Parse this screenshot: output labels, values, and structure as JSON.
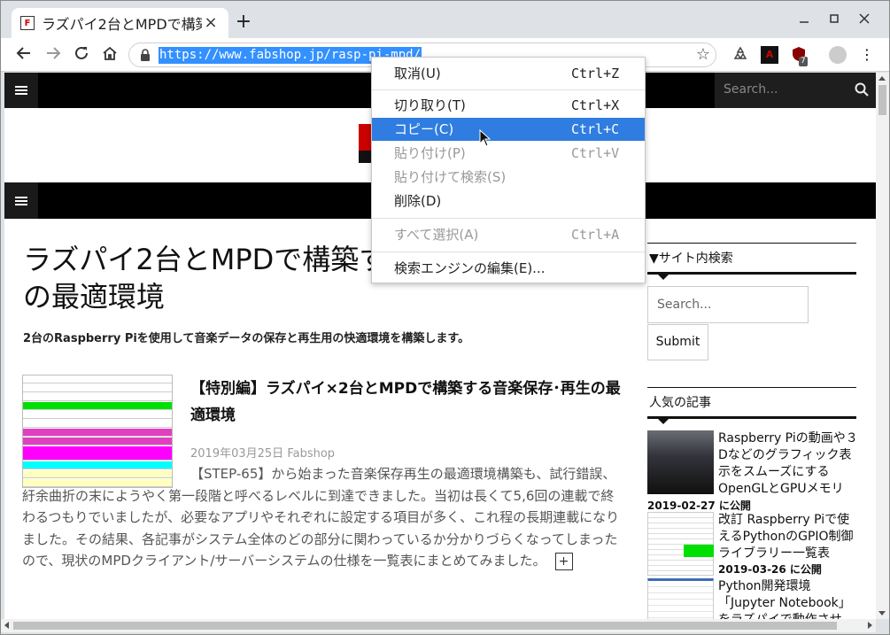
{
  "browser": {
    "tab_title": "ラズパイ2台とMPDで構築",
    "tab_favicon_text": "F",
    "new_tab": "+",
    "tab_close": "×",
    "url": "https://www.fabshop.jp/rasp-pi-mpd/",
    "ext_badge": "7"
  },
  "context_menu": {
    "items": [
      {
        "label": "取消(U)",
        "shortcut": "Ctrl+Z"
      },
      {
        "label": "切り取り(T)",
        "shortcut": "Ctrl+X"
      },
      {
        "label": "コピー(C)",
        "shortcut": "Ctrl+C"
      },
      {
        "label": "貼り付け(P)",
        "shortcut": "Ctrl+V"
      },
      {
        "label": "貼り付けて検索(S)",
        "shortcut": ""
      },
      {
        "label": "削除(D)",
        "shortcut": ""
      },
      {
        "label": "すべて選択(A)",
        "shortcut": "Ctrl+A"
      },
      {
        "label": "検索エンジンの編集(E)...",
        "shortcut": ""
      }
    ]
  },
  "site": {
    "top_search_placeholder": "Search...",
    "page_title": "ラズパイ2台とMPDで構築す\nの最適環境",
    "page_title_line1": "ラズパイ2台とMPDで構築す",
    "page_title_line2": "の最適環境",
    "page_desc": "2台のRaspberry Piを使用して音楽データの保存と再生用の快適環境を構築します。",
    "post": {
      "title": "【特別編】ラズパイ×2台とMPDで構築する音楽保存･再生の最適環境",
      "date": "2019年03月25日",
      "author": "Fabshop",
      "body": "【STEP-65】から始まった音楽保存再生の最適環境構築も、試行錯誤、紆余曲折の末にようやく第一段階と呼べるレベルに到達できました。当初は長くて5,6回の連載で終わるつもりでいましたが、必要なアプリやそれぞれに設定する項目が多く、これ程の長期連載になりました。その結果、各記事がシステム全体のどの部分に関わっているか分かりづらくなってしまったので、現状のMPDクライアント/サーバーシステムの仕様を一覧表にまとめてみました。",
      "more": "+"
    },
    "sidebar": {
      "search_heading": "▼サイト内検索",
      "search_placeholder": "Search...",
      "submit_label": "Submit",
      "popular_heading": "人気の記事",
      "popular": [
        {
          "title": "Raspberry Piの動画や３Dなどのグラフィック表示をスムーズにするOpenGLとGPUメモリ",
          "date": "2019-02-27 に公開"
        },
        {
          "title": "改訂 Raspberry Piで使えるPythonのGPIO制御ライブラリー一覧表",
          "date": "2019-03-26 に公開"
        },
        {
          "title": "Python開発環境「Jupyter Notebook」をラズパイで動作させ",
          "date": ""
        }
      ]
    }
  },
  "colors": {
    "highlight": "#2f7de1",
    "url_selection": "#3390ff",
    "logo_red": "#cc0000"
  }
}
